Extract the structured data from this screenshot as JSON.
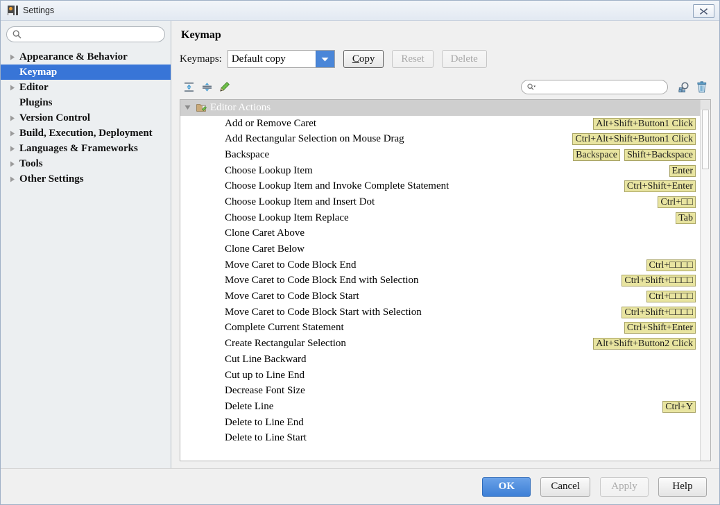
{
  "window": {
    "title": "Settings",
    "app_icon": "intellij-icon",
    "close_label": "×"
  },
  "sidebar": {
    "search": {
      "placeholder": "",
      "value": "",
      "icon": "search-icon"
    },
    "items": [
      {
        "label": "Appearance & Behavior",
        "expandable": true,
        "selected": false
      },
      {
        "label": "Keymap",
        "expandable": false,
        "selected": true
      },
      {
        "label": "Editor",
        "expandable": true,
        "selected": false
      },
      {
        "label": "Plugins",
        "expandable": false,
        "selected": false
      },
      {
        "label": "Version Control",
        "expandable": true,
        "selected": false
      },
      {
        "label": "Build, Execution, Deployment",
        "expandable": true,
        "selected": false
      },
      {
        "label": "Languages & Frameworks",
        "expandable": true,
        "selected": false
      },
      {
        "label": "Tools",
        "expandable": true,
        "selected": false
      },
      {
        "label": "Other Settings",
        "expandable": true,
        "selected": false
      }
    ]
  },
  "panel": {
    "title": "Keymap",
    "keymaps_label": "Keymaps:",
    "combo": {
      "value": "Default copy",
      "arrow_icon": "chevron-down-icon"
    },
    "buttons": [
      {
        "label": "Copy",
        "mnemonic": "C",
        "enabled": true,
        "default": true
      },
      {
        "label": "Reset",
        "mnemonic": "",
        "enabled": false,
        "default": false
      },
      {
        "label": "Delete",
        "mnemonic": "",
        "enabled": false,
        "default": false
      }
    ],
    "toolbar": {
      "expand_all": "expand-all-icon",
      "collapse_all": "collapse-all-icon",
      "edit": "edit-pencil-icon",
      "search": {
        "placeholder": "",
        "value": "",
        "icon": "search-dropdown-icon"
      },
      "find_shortcut": "find-shortcut-icon",
      "reset_shortcut": "trash-icon"
    }
  },
  "table": {
    "group": {
      "label": "Editor Actions",
      "icon": "folder-edit-icon",
      "expanded": true,
      "selected": true
    },
    "rows": [
      {
        "name": "Add or Remove Caret",
        "keys": [
          "Alt+Shift+Button1 Click"
        ]
      },
      {
        "name": "Add Rectangular Selection on Mouse Drag",
        "keys": [
          "Ctrl+Alt+Shift+Button1 Click"
        ]
      },
      {
        "name": "Backspace",
        "keys": [
          "Backspace",
          "Shift+Backspace"
        ]
      },
      {
        "name": "Choose Lookup Item",
        "keys": [
          "Enter"
        ]
      },
      {
        "name": "Choose Lookup Item and Invoke Complete Statement",
        "keys": [
          "Ctrl+Shift+Enter"
        ]
      },
      {
        "name": "Choose Lookup Item and Insert Dot",
        "keys": [
          "Ctrl+□□"
        ]
      },
      {
        "name": "Choose Lookup Item Replace",
        "keys": [
          "Tab"
        ]
      },
      {
        "name": "Clone Caret Above",
        "keys": []
      },
      {
        "name": "Clone Caret Below",
        "keys": []
      },
      {
        "name": "Move Caret to Code Block End",
        "keys": [
          "Ctrl+□□□□"
        ]
      },
      {
        "name": "Move Caret to Code Block End with Selection",
        "keys": [
          "Ctrl+Shift+□□□□"
        ]
      },
      {
        "name": "Move Caret to Code Block Start",
        "keys": [
          "Ctrl+□□□□"
        ]
      },
      {
        "name": "Move Caret to Code Block Start with Selection",
        "keys": [
          "Ctrl+Shift+□□□□"
        ]
      },
      {
        "name": "Complete Current Statement",
        "keys": [
          "Ctrl+Shift+Enter"
        ]
      },
      {
        "name": "Create Rectangular Selection",
        "keys": [
          "Alt+Shift+Button2 Click"
        ]
      },
      {
        "name": "Cut Line Backward",
        "keys": []
      },
      {
        "name": "Cut up to Line End",
        "keys": []
      },
      {
        "name": "Decrease Font Size",
        "keys": []
      },
      {
        "name": "Delete Line",
        "keys": [
          "Ctrl+Y"
        ]
      },
      {
        "name": "Delete to Line End",
        "keys": []
      },
      {
        "name": "Delete to Line Start",
        "keys": []
      }
    ]
  },
  "footer": {
    "buttons": [
      {
        "label": "OK",
        "enabled": true,
        "primary": true
      },
      {
        "label": "Cancel",
        "enabled": true,
        "primary": false
      },
      {
        "label": "Apply",
        "enabled": false,
        "primary": false
      },
      {
        "label": "Help",
        "enabled": true,
        "primary": false
      }
    ]
  },
  "colors": {
    "selection_blue": "#3875d7",
    "shortcut_badge": "#e8e4a0",
    "shortcut_badge_border": "#a9a465",
    "group_row": "#cfcfcf",
    "primary_button": "#3d7fd6"
  }
}
